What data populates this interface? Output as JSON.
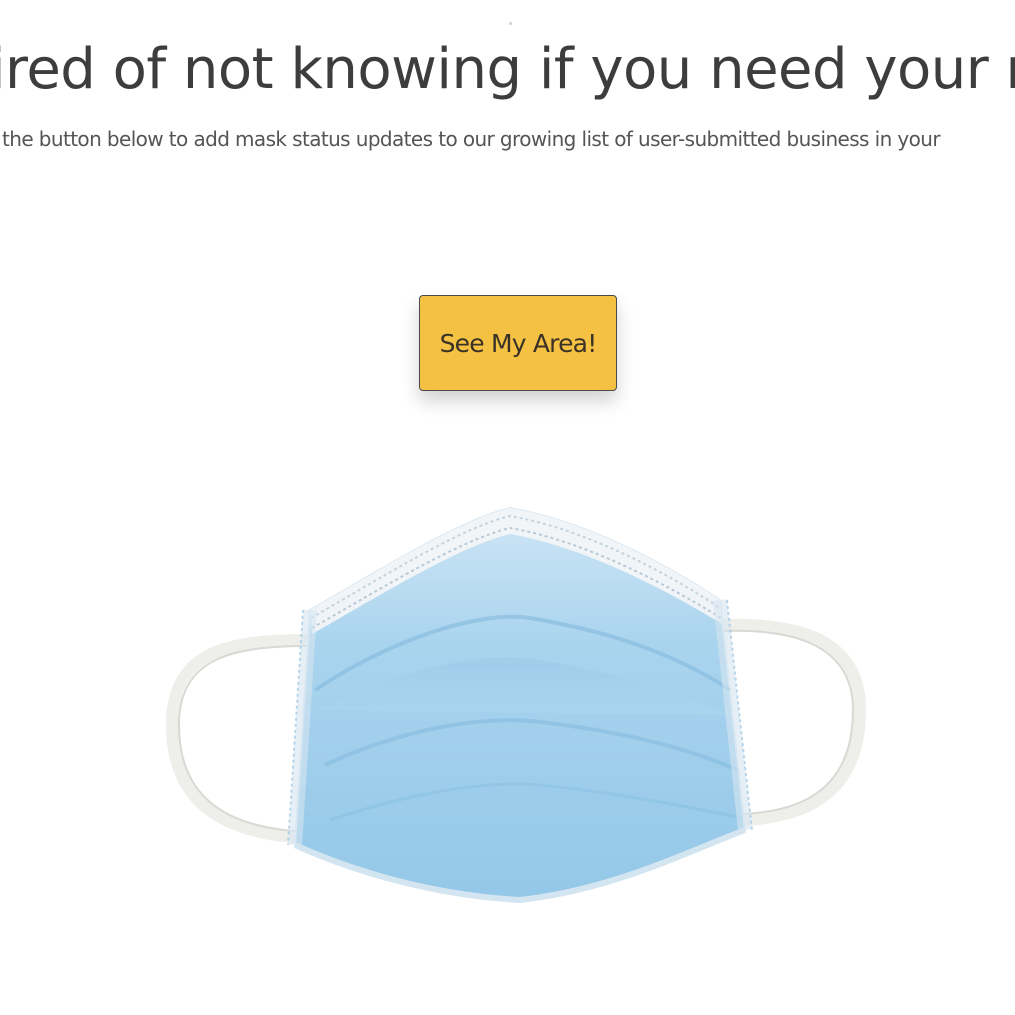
{
  "hero": {
    "title": "ired of not knowing if you need your mas",
    "subtitle": "the button below to add mask status updates to our growing list of user-submitted business in your",
    "cta_label": "See My Area!"
  },
  "colors": {
    "cta_background": "#f5c143",
    "text": "#3d3d3d",
    "mask": "#a9d4ee"
  },
  "icons": {
    "mask": "surgical-mask-image"
  }
}
